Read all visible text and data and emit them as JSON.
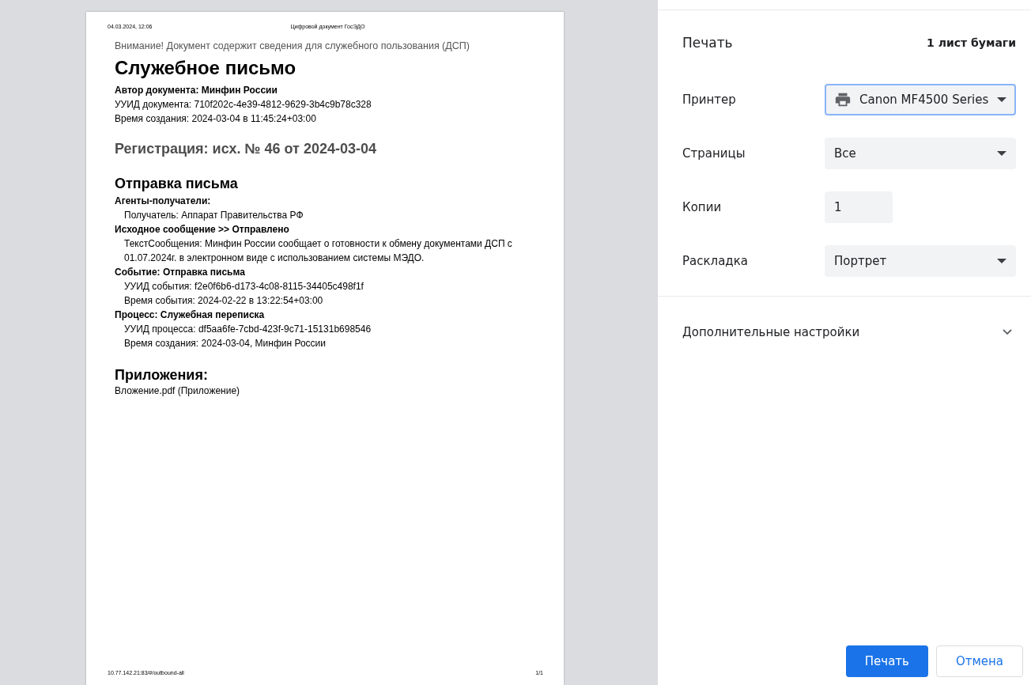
{
  "preview": {
    "header_left": "04.03.2024, 12:06",
    "header_center": "Цифровой документ ГосЭДО",
    "lines": [
      {
        "kind": "notice",
        "text": "Внимание! Документ содержит сведения для служебного пользования (ДСП)"
      },
      {
        "kind": "title",
        "text": "Служебное письмо"
      },
      {
        "kind": "bold",
        "text": "Автор документа: Минфин России"
      },
      {
        "kind": "plain",
        "text": "УУИД документа: 710f202c-4e39-4812-9629-3b4c9b78c328"
      },
      {
        "kind": "plain",
        "text": "Время создания: 2024-03-04 в 11:45:24+03:00"
      },
      {
        "kind": "registration",
        "text": "Регистрация: исх. № 46 от 2024-03-04"
      },
      {
        "kind": "section",
        "text": "Отправка письма"
      },
      {
        "kind": "bold",
        "text": "Агенты-получатели:"
      },
      {
        "kind": "indent",
        "text": "Получатель: Аппарат Правительства РФ"
      },
      {
        "kind": "bold",
        "text": "Исходное сообщение >> Отправлено"
      },
      {
        "kind": "indent",
        "text": "ТекстСообщения: Минфин России сообщает о готовности к обмену документами ДСП с 01.07.2024г. в электронном виде с использованием системы МЭДО."
      },
      {
        "kind": "bold",
        "text": "Событие: Отправка письма"
      },
      {
        "kind": "indent",
        "text": "УУИД события: f2e0f6b6-d173-4c08-8115-34405c498f1f"
      },
      {
        "kind": "indent",
        "text": "Время события: 2024-02-22 в 13:22:54+03:00"
      },
      {
        "kind": "bold",
        "text": "Процесс: Служебная переписка"
      },
      {
        "kind": "indent",
        "text": "УУИД процесса: df5aa6fe-7cbd-423f-9c71-15131b698546"
      },
      {
        "kind": "indent",
        "text": "Время создания: 2024-03-04, Минфин России"
      },
      {
        "kind": "section",
        "text": "Приложения:"
      },
      {
        "kind": "plain",
        "text": "Вложение.pdf (Приложение)"
      }
    ],
    "footer_left": "10.77.142.21:83/#/outbound-all",
    "footer_right": "1/1"
  },
  "settings": {
    "title": "Печать",
    "sheets": "1 лист бумаги",
    "rows": [
      {
        "label": "Принтер",
        "kind": "select",
        "value": "Canon MF4500 Series",
        "focused": true
      },
      {
        "label": "Страницы",
        "kind": "select",
        "value": "Все",
        "focused": false
      },
      {
        "label": "Копии",
        "kind": "number",
        "value": "1",
        "focused": false
      },
      {
        "label": "Раскладка",
        "kind": "select",
        "value": "Портрет",
        "focused": false
      }
    ],
    "more": {
      "label": "Дополнительные настройки",
      "expanded": false
    },
    "buttons": [
      {
        "label": "Печать",
        "kind": "primary"
      },
      {
        "label": "Отмена",
        "kind": "secondary"
      }
    ]
  }
}
